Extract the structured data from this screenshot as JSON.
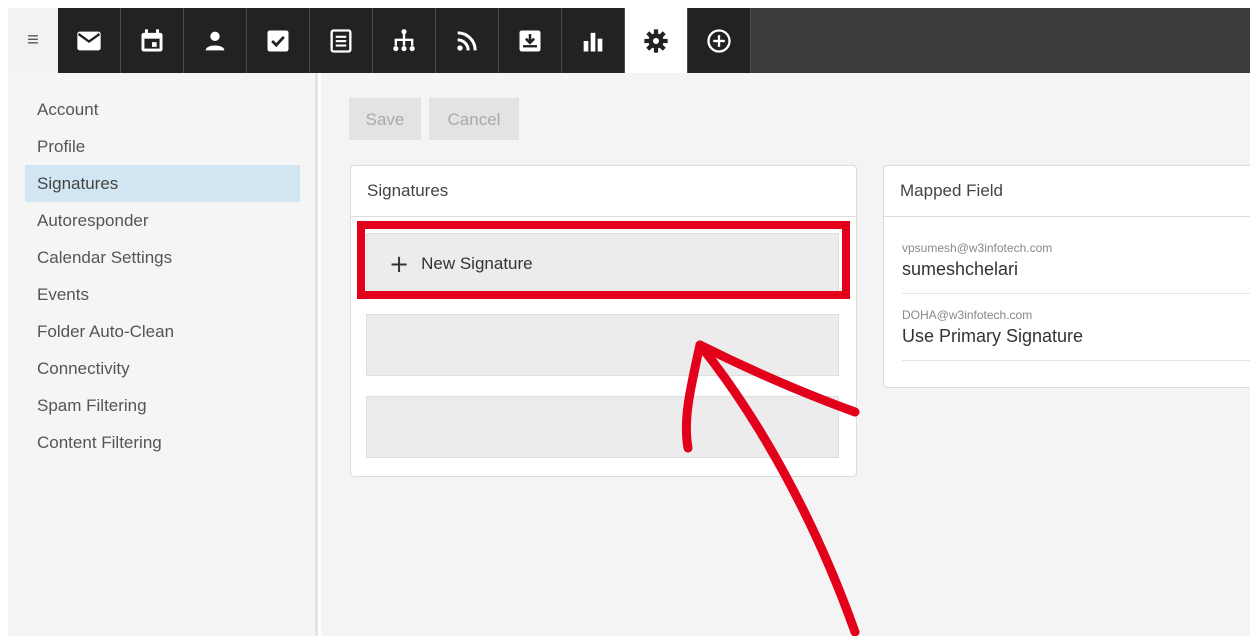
{
  "toolbar": {
    "icons": [
      "menu-icon",
      "mail-icon",
      "calendar-icon",
      "contacts-icon",
      "tasks-icon",
      "notes-icon",
      "sitemap-icon",
      "rss-icon",
      "archive-icon",
      "stats-icon",
      "settings-icon",
      "add-circle-icon"
    ],
    "active": "settings-icon",
    "menu_glyph": "≡"
  },
  "sidebar": {
    "items": [
      {
        "label": "Account"
      },
      {
        "label": "Profile"
      },
      {
        "label": "Signatures"
      },
      {
        "label": "Autoresponder"
      },
      {
        "label": "Calendar Settings"
      },
      {
        "label": "Events"
      },
      {
        "label": "Folder Auto-Clean"
      },
      {
        "label": "Connectivity"
      },
      {
        "label": "Spam Filtering"
      },
      {
        "label": "Content Filtering"
      }
    ],
    "active_index": 2
  },
  "actions": {
    "save_label": "Save",
    "cancel_label": "Cancel"
  },
  "signatures_panel": {
    "title": "Signatures",
    "new_signature_label": "New Signature",
    "plus_glyph": "+"
  },
  "mapped_panel": {
    "title": "Mapped Field",
    "rows": [
      {
        "email": "vpsumesh@w3infotech.com",
        "value": "sumeshchelari"
      },
      {
        "email": "DOHA@w3infotech.com",
        "value": "Use Primary Signature"
      }
    ]
  },
  "colors": {
    "toolbar": "#222222",
    "highlight": "#e3001b",
    "active_sidebar": "#d1e5f2"
  }
}
